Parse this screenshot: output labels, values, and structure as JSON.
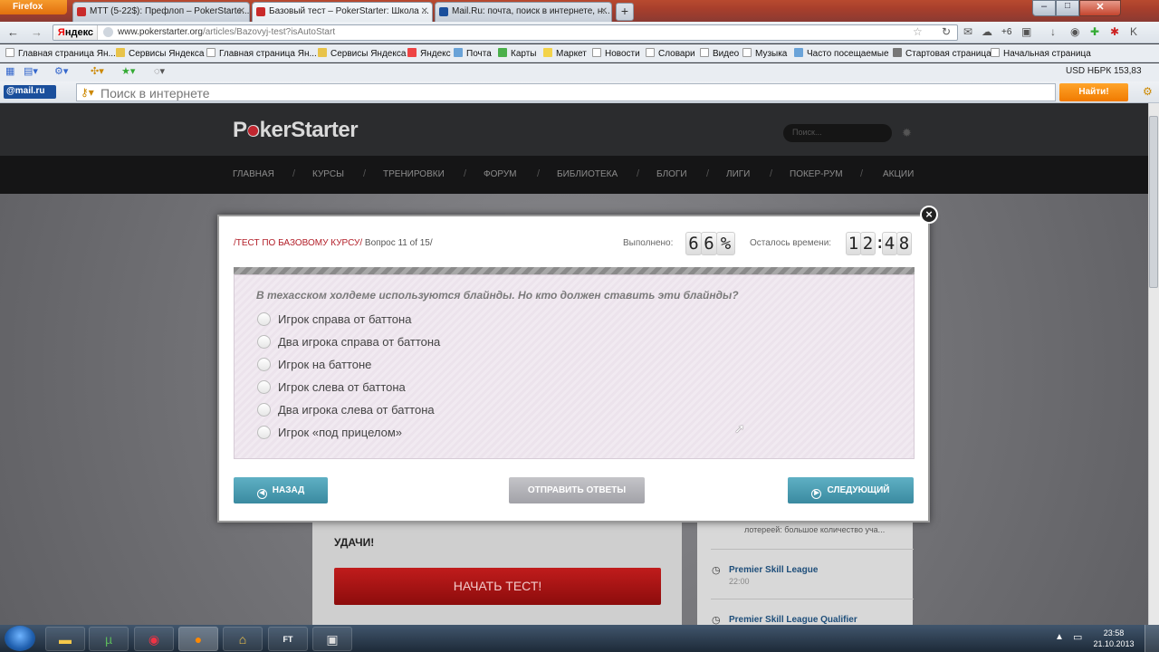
{
  "browser": {
    "menu_label": "Firefox",
    "tabs": [
      {
        "label": "MTT (5-22$): Префлоп – PokerStarte...",
        "active": false
      },
      {
        "label": "Базовый тест – PokerStarter: Школа ...",
        "active": true
      },
      {
        "label": "Mail.Ru: почта, поиск в интернете, н...",
        "active": false
      }
    ],
    "new_tab": "+",
    "yandex_button": "Яндекс",
    "url_domain": "www.pokerstarter.org",
    "url_path": "/articles/Bazovyj-test?isAutoStart",
    "bookmarks": [
      "Главная страница Ян...",
      "Сервисы Яндекса",
      "Главная страница Ян...",
      "Сервисы Яндекса",
      "Яндекс",
      "Почта",
      "Карты",
      "Маркет",
      "Новости",
      "Словари",
      "Видео",
      "Музыка",
      "Часто посещаемые",
      "Стартовая страница",
      "Начальная страница"
    ],
    "toolbar_extra": "+6",
    "currency": "USD НБРК 153,83",
    "mail_logo": "@mail.ru",
    "search_placeholder": "Поиск в интернете",
    "find_button": "Найти!"
  },
  "site": {
    "logo": "PokerStarter",
    "search_placeholder": "Поиск...",
    "nav": [
      "ГЛАВНАЯ",
      "КУРСЫ",
      "ТРЕНИРОВКИ",
      "ФОРУМ",
      "БИБЛИОТЕКА",
      "БЛОГИ",
      "ЛИГИ",
      "ПОКЕР-РУМ",
      "АКЦИИ"
    ],
    "good_luck": "УДАЧИ!",
    "start_button": "НАЧАТЬ ТЕСТ!",
    "right_snippet": "лотереей: большое количество уча...",
    "right_links": [
      {
        "title": "Premier Skill League",
        "time": "22:00"
      },
      {
        "title": "Premier Skill League Qualifier",
        "time": ""
      }
    ]
  },
  "modal": {
    "crumb_course": "/ТЕСТ ПО БАЗОВОМУ КУРСУ/",
    "crumb_question": "Вопрос 11 of 15/",
    "done_label": "Выполнено:",
    "done_digits": [
      "6",
      "6",
      "%"
    ],
    "progress_percent": 66,
    "time_label": "Осталось времени:",
    "time_digits": [
      "1",
      "2",
      ":",
      "4",
      "8"
    ],
    "question": "В техасском холдеме используются блайнды. Но кто должен ставить эти блайнды?",
    "options": [
      "Игрок справа от баттона",
      "Два игрока справа от баттона",
      "Игрок на баттоне",
      "Игрок слева от баттона",
      "Два игрока слева от баттона",
      "Игрок «под прицелом»"
    ],
    "back_button": "НАЗАД",
    "submit_button": "ОТПРАВИТЬ ОТВЕТЫ",
    "next_button": "СЛЕДУЮЩИЙ",
    "close": "×"
  },
  "taskbar": {
    "time": "23:58",
    "date": "21.10.2013"
  }
}
